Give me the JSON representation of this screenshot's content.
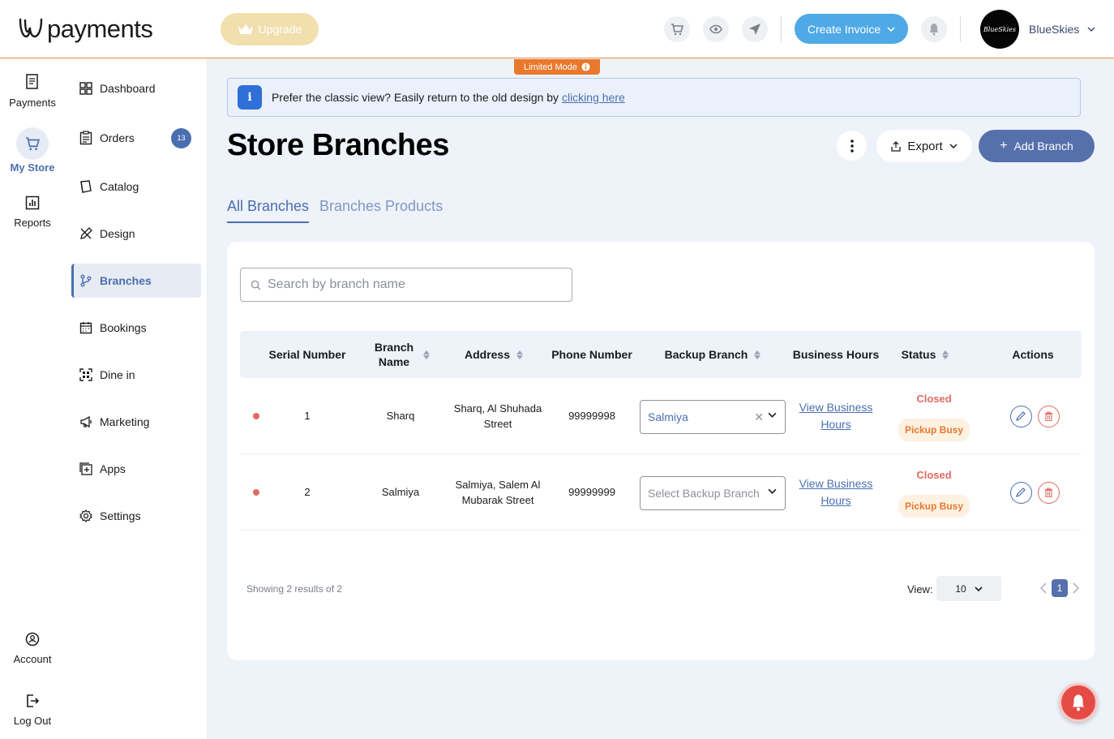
{
  "header": {
    "logo_text": "payments",
    "upgrade_label": "Upgrade",
    "create_invoice_label": "Create Invoice",
    "avatar_text": "BlueSkies",
    "user_name": "BlueSkies"
  },
  "rail": {
    "items": [
      {
        "label": "Payments",
        "icon": "payments-doc-icon"
      },
      {
        "label": "My Store",
        "icon": "cart-icon",
        "active": true
      },
      {
        "label": "Reports",
        "icon": "reports-chart-icon"
      }
    ],
    "bottom": [
      {
        "label": "Account",
        "icon": "account-icon"
      },
      {
        "label": "Log Out",
        "icon": "logout-icon"
      }
    ]
  },
  "sidebar": {
    "items": [
      {
        "label": "Dashboard",
        "icon": "dashboard-grid-icon"
      },
      {
        "label": "Orders",
        "icon": "orders-clipboard-icon",
        "badge": "13"
      },
      {
        "label": "Catalog",
        "icon": "catalog-book-icon"
      },
      {
        "label": "Design",
        "icon": "design-pencil-icon"
      },
      {
        "label": "Branches",
        "icon": "branches-fork-icon",
        "active": true
      },
      {
        "label": "Bookings",
        "icon": "bookings-calendar-icon"
      },
      {
        "label": "Dine in",
        "icon": "dine-in-qr-icon"
      },
      {
        "label": "Marketing",
        "icon": "marketing-megaphone-icon"
      },
      {
        "label": "Apps",
        "icon": "apps-plus-icon"
      },
      {
        "label": "Settings",
        "icon": "settings-gear-icon"
      }
    ]
  },
  "limited_mode_label": "Limited Mode",
  "banner": {
    "text": "Prefer the classic view? Easily return to the old design by",
    "link": "clicking here"
  },
  "page": {
    "title": "Store Branches",
    "export_label": "Export",
    "add_branch_label": "Add Branch"
  },
  "tabs": [
    {
      "label": "All Branches",
      "active": true
    },
    {
      "label": "Branches Products",
      "active": false
    }
  ],
  "search": {
    "placeholder": "Search by branch name"
  },
  "table": {
    "columns": [
      "Serial Number",
      "Branch Name",
      "Address",
      "Phone Number",
      "Backup Branch",
      "Business Hours",
      "Status",
      "Actions"
    ],
    "rows": [
      {
        "serial": "1",
        "name": "Sharq",
        "address": "Sharq, Al Shuhada Street",
        "phone": "99999998",
        "backup": "Salmiya",
        "backup_placeholder": "",
        "hours_link": "View Business Hours",
        "status": "Closed",
        "status_tag": "Pickup Busy"
      },
      {
        "serial": "2",
        "name": "Salmiya",
        "address": "Salmiya, Salem Al Mubarak Street",
        "phone": "99999999",
        "backup": "",
        "backup_placeholder": "Select Backup Branch",
        "hours_link": "View Business Hours",
        "status": "Closed",
        "status_tag": "Pickup Busy"
      }
    ]
  },
  "footer": {
    "showing": "Showing 2 results of 2",
    "view_label": "View:",
    "view_value": "10",
    "current_page": "1"
  },
  "colors": {
    "accent": "#4a6fb0",
    "invoice_blue": "#4fa9e6",
    "limited_orange": "#e8782c",
    "closed_red": "#e06b62"
  }
}
